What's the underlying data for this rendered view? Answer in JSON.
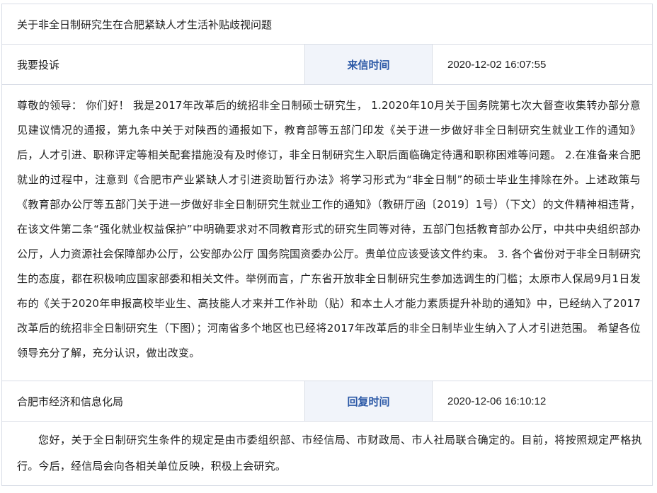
{
  "letter": {
    "title": "关于非全日制研究生在合肥紧缺人才生活补贴歧视问题",
    "sender": "我要投诉",
    "sent_label": "来信时间",
    "sent_time": "2020-12-02 16:07:55",
    "content": "尊敬的领导： 你们好！ 我是2017年改革后的统招非全日制硕士研究生， 1.2020年10月关于国务院第七次大督查收集转办部分意见建议情况的通报，第九条中关于对陕西的通报如下，教育部等五部门印发《关于进一步做好非全日制研究生就业工作的通知》后，人才引进、职称评定等相关配套措施没有及时修订，非全日制研究生入职后面临确定待遇和职称困难等问题。 2.在准备来合肥就业的过程中，注意到《合肥市产业紧缺人才引进资助暂行办法》将学习形式为“非全日制”的硕士毕业生排除在外。上述政策与《教育部办公厅等五部门关于进一步做好非全日制研究生就业工作的通知》（教研厅函〔2019〕1号）（下文）的文件精神相违背，在该文件第二条“强化就业权益保护”中明确要求对不同教育形式的研究生同等对待，五部门包括教育部办公厅，中共中央组织部办公厅，人力资源社会保障部办公厅，公安部办公厅 国务院国资委办公厅。贵单位应该受该文件约束。 3. 各个省份对于非全日制研究生的态度，都在积极响应国家部委和相关文件。举例而言，广东省开放非全日制研究生参加选调生的门槛；太原市人保局9月1日发布的《关于2020年申报高校毕业生、高技能人才来并工作补助（贴）和本土人才能力素质提升补助的通知》中，已经纳入了2017改革后的统招非全日制研究生（下图）；河南省多个地区也已经将2017年改革后的非全日制毕业生纳入了人才引进范围。 希望各位领导充分了解，充分认识，做出改变。"
  },
  "reply": {
    "department": "合肥市经济和信息化局",
    "reply_label": "回复时间",
    "reply_time": "2020-12-06 16:10:12",
    "content": "您好，关于全日制研究生条件的规定是由市委组织部、市经信局、市财政局、市人社局联合确定的。目前，将按照规定严格执行。今后，经信局会向各相关单位反映，积极上会研究。"
  }
}
